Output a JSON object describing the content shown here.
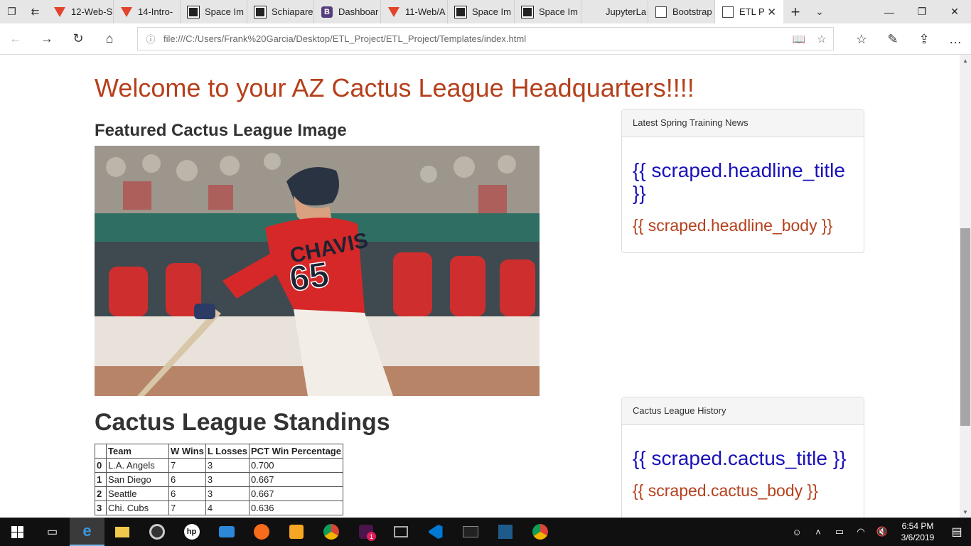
{
  "browser": {
    "tabs": [
      {
        "label": "12-Web-S",
        "icon": "gitlab-icon"
      },
      {
        "label": "14-Intro-",
        "icon": "gitlab-icon"
      },
      {
        "label": "Space Im",
        "icon": "space-image-icon"
      },
      {
        "label": "Schiapare",
        "icon": "space-image-icon"
      },
      {
        "label": "Dashboar",
        "icon": "bootstrap-icon"
      },
      {
        "label": "11-Web/A",
        "icon": "gitlab-icon"
      },
      {
        "label": "Space Im",
        "icon": "space-image-icon"
      },
      {
        "label": "Space Im",
        "icon": "space-image-icon"
      },
      {
        "label": "JupyterLa",
        "icon": "none"
      },
      {
        "label": "Bootstrap",
        "icon": "page-icon"
      },
      {
        "label": "ETL P",
        "icon": "page-icon",
        "active": true
      }
    ],
    "url": "file:///C:/Users/Frank%20Garcia/Desktop/ETL_Project/ETL_Project/Templates/index.html"
  },
  "page": {
    "welcome": "Welcome to your AZ Cactus League Headquarters!!!!",
    "featured_heading": "Featured Cactus League Image",
    "standings_heading": "Cactus League Standings",
    "standings": {
      "headers": [
        "",
        "Team",
        "W Wins",
        "L Losses",
        "PCT Win Percentage"
      ],
      "rows": [
        [
          "0",
          "L.A. Angels",
          "7",
          "3",
          "0.700"
        ],
        [
          "1",
          "San Diego",
          "6",
          "3",
          "0.667"
        ],
        [
          "2",
          "Seattle",
          "6",
          "3",
          "0.667"
        ],
        [
          "3",
          "Chi. Cubs",
          "7",
          "4",
          "0.636"
        ]
      ]
    },
    "news_panel": {
      "heading": "Latest Spring Training News",
      "title": "{{ scraped.headline_title }}",
      "body": "{{ scraped.headline_body }}"
    },
    "history_panel": {
      "heading": "Cactus League History",
      "title": "{{ scraped.cactus_title }}",
      "body": "{{ scraped.cactus_body }}"
    },
    "photo": {
      "jersey_name": "CHAVIS",
      "jersey_number": "65"
    }
  },
  "taskbar": {
    "time": "6:54 PM",
    "date": "3/6/2019",
    "slack_badge": "1"
  },
  "colors": {
    "heading_orange": "#b5401b",
    "template_blue": "#1a12b8"
  }
}
